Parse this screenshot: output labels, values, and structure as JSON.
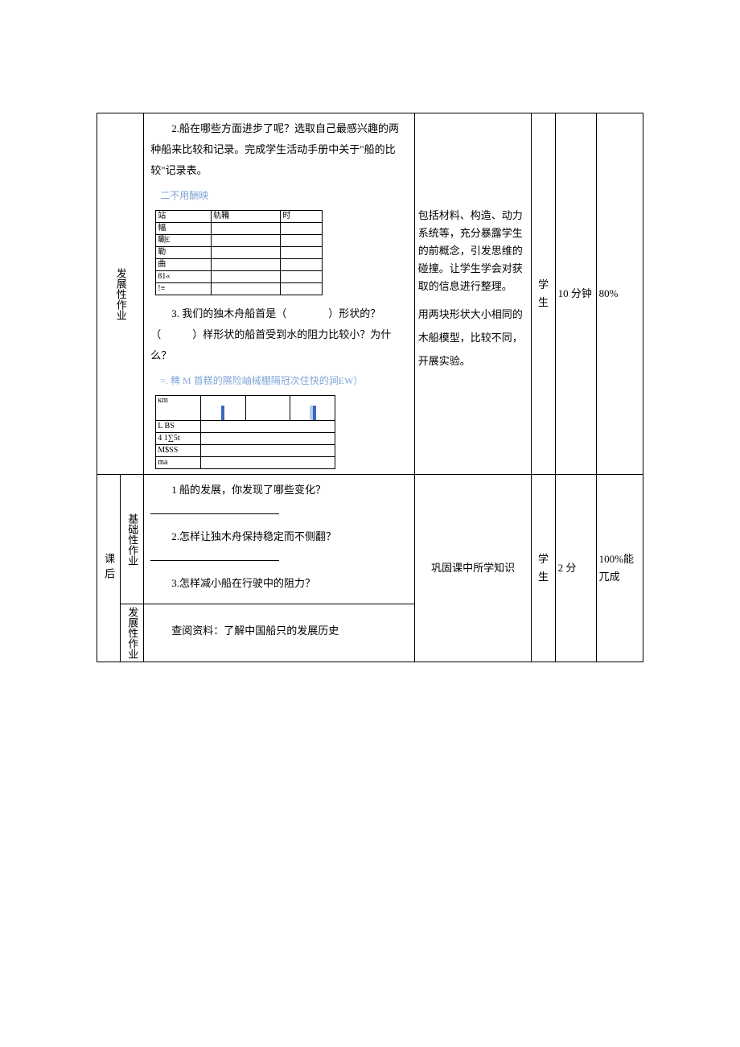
{
  "rows": {
    "r1": {
      "category": "发展性作业",
      "content": {
        "q2": "2.船在哪些方面进步了呢？选取自己最感兴趣的两种船来比较和记录。完成学生活动手册中关于\"船的比较\"记录表。",
        "faint1": "二不用酬映",
        "inner_table_cells": {
          "c1": "站",
          "c2": "轨鞴",
          "c3": "时",
          "c4": "幅",
          "c5": "唰£",
          "c6": "勒",
          "c7": "曲",
          "c8": "81«",
          "c9": "!≡"
        },
        "q3": "3. 我们的独木舟船首是（　　　　）形状的？（　　　）样形状的船首受到水的阻力比较小？为什么？",
        "faint2": "=. 稗 M 首糕的隰险岫械棚隔冠次住快的涧EW）",
        "inner2_cells": {
          "c1": "кm",
          "c2": "L BS",
          "c3": "4 1∑5t",
          "c4": "M$SS",
          "c5": "ma"
        }
      },
      "feedback": {
        "p1": "包括材料、构造、动力系统等，充分暴露学生的前概念，引发思维的碰撞。让学生学会对获取的信息进行整理。",
        "p2": "用两块形状大小相同的木船模型，比较不同，开展实验。"
      },
      "who": "学生",
      "time": "10 分钟",
      "pct": "80%"
    },
    "r2": {
      "stage": "课后",
      "cat_basic": "基础性作业",
      "cat_dev": "发展性作业",
      "content_basic": {
        "q1": "1 船的发展，你发现了哪些变化？",
        "q2": "2.怎样让独木舟保持稳定而不侧翻？",
        "q3": "3.怎样减小船在行驶中的阻力？"
      },
      "content_dev": "查阅资料：了解中国船只的发展历史",
      "feedback": "巩固课中所学知识",
      "who": "学生",
      "time": "2 分",
      "pct": "100%能兀成"
    }
  }
}
